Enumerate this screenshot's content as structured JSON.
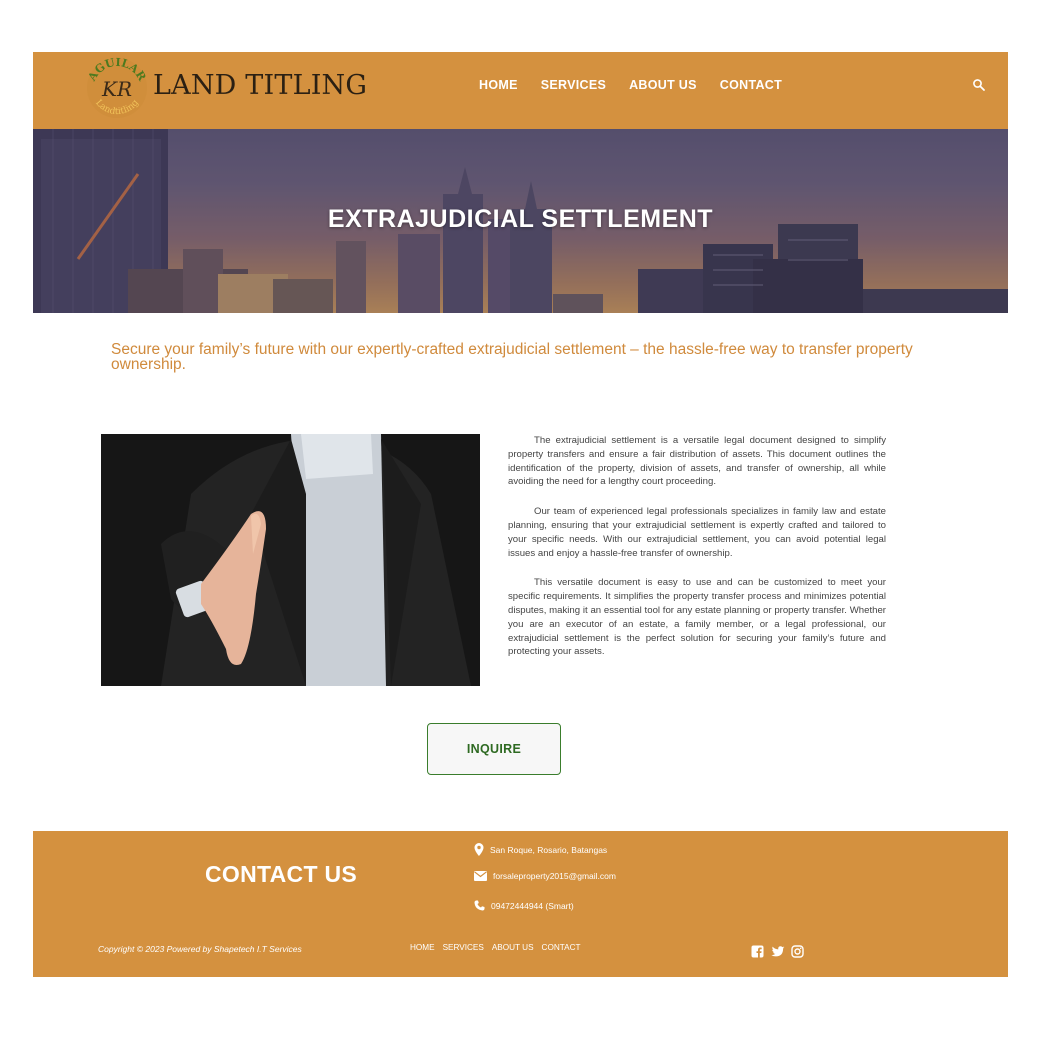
{
  "brand": {
    "logo_emblem_text_top": "AGUILAR",
    "logo_emblem_text_mid": "KR",
    "logo_emblem_text_bottom": "Landtitling",
    "logo_text": "LAND TITLING"
  },
  "nav": {
    "items": [
      "HOME",
      "SERVICES",
      "ABOUT US",
      "CONTACT"
    ]
  },
  "hero": {
    "title": "EXTRAJUDICIAL SETTLEMENT"
  },
  "tagline": "Secure your family’s future with our expertly-crafted extrajudicial settlement – the hassle-free way to transfer property ownership.",
  "content": {
    "paragraphs": [
      "The extrajudicial settlement is a versatile legal document designed to simplify property transfers and ensure a fair distribution of assets. This document outlines the identification of the property, division of assets, and transfer of ownership, all while avoiding the need for a lengthy court proceeding.",
      "Our team of experienced legal professionals specializes in family law and estate planning, ensuring that your extrajudicial settlement is expertly crafted and tailored to your specific needs. With our extrajudicial settlement, you can avoid potential legal issues and enjoy a hassle-free transfer of ownership.",
      "This versatile document is easy to use and can be customized to meet your specific requirements. It simplifies the property transfer process and minimizes potential disputes, making it an essential tool for any estate planning or property transfer. Whether you are an executor of an estate, a family member, or a legal professional, our extrajudicial settlement is the perfect solution for securing your family’s future and protecting your assets."
    ],
    "inquire_label": "INQUIRE"
  },
  "footer": {
    "contact_title": "CONTACT US",
    "address": "San Roque, Rosario, Batangas",
    "email": "forsaleproperty2015@gmail.com",
    "phone": "09472444944 (Smart)",
    "copyright": "Copyright © 2023 Powered by Shapetech I.T Services",
    "nav_items": [
      "HOME",
      "SERVICES",
      "ABOUT US",
      "CONTACT"
    ],
    "social_icons": [
      "facebook-icon",
      "twitter-icon",
      "instagram-icon"
    ]
  },
  "colors": {
    "brand_orange": "#d4913f",
    "tagline_orange": "#d08a3c",
    "button_green": "#2e6a22"
  }
}
